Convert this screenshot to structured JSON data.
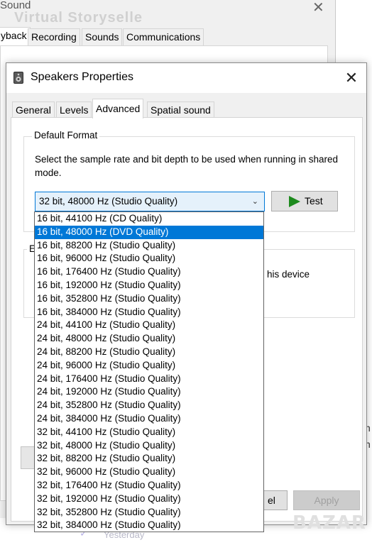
{
  "background": {
    "watermark_text": "Virtual Storyselle",
    "yesterday": "Yesterday",
    "right_fragment_1": "n",
    "right_fragment_2": "n",
    "bazar_watermark": "BAZAR"
  },
  "sound_window": {
    "title": "Sound",
    "close_glyph": "✕",
    "tabs": [
      "yback",
      "Recording",
      "Sounds",
      "Communications"
    ]
  },
  "dialog": {
    "title": "Speakers Properties",
    "close_glyph": "✕",
    "tabs": [
      "General",
      "Levels",
      "Advanced",
      "Spatial sound"
    ],
    "active_tab": "Advanced",
    "default_format": {
      "group_label": "Default Format",
      "description": "Select the sample rate and bit depth to be used when running in shared mode.",
      "selected_value": "32 bit, 48000 Hz (Studio Quality)",
      "test_label": "Test"
    },
    "exclusive_partial_label": "E",
    "exclusive_partial_text": "his device",
    "buttons": {
      "cancel_partial": "el",
      "apply": "Apply"
    },
    "dropdown_options": [
      "16 bit, 44100 Hz (CD Quality)",
      "16 bit, 48000 Hz (DVD Quality)",
      "16 bit, 88200 Hz (Studio Quality)",
      "16 bit, 96000 Hz (Studio Quality)",
      "16 bit, 176400 Hz (Studio Quality)",
      "16 bit, 192000 Hz (Studio Quality)",
      "16 bit, 352800 Hz (Studio Quality)",
      "16 bit, 384000 Hz (Studio Quality)",
      "24 bit, 44100 Hz (Studio Quality)",
      "24 bit, 48000 Hz (Studio Quality)",
      "24 bit, 88200 Hz (Studio Quality)",
      "24 bit, 96000 Hz (Studio Quality)",
      "24 bit, 176400 Hz (Studio Quality)",
      "24 bit, 192000 Hz (Studio Quality)",
      "24 bit, 352800 Hz (Studio Quality)",
      "24 bit, 384000 Hz (Studio Quality)",
      "32 bit, 44100 Hz (Studio Quality)",
      "32 bit, 48000 Hz (Studio Quality)",
      "32 bit, 88200 Hz (Studio Quality)",
      "32 bit, 96000 Hz (Studio Quality)",
      "32 bit, 176400 Hz (Studio Quality)",
      "32 bit, 192000 Hz (Studio Quality)",
      "32 bit, 352800 Hz (Studio Quality)",
      "32 bit, 384000 Hz (Studio Quality)"
    ],
    "highlighted_option": "16 bit, 48000 Hz (DVD Quality)"
  },
  "colors": {
    "accent": "#0078d7",
    "play_icon": "#1d8a1d",
    "window_bg": "#f0f0f0"
  }
}
